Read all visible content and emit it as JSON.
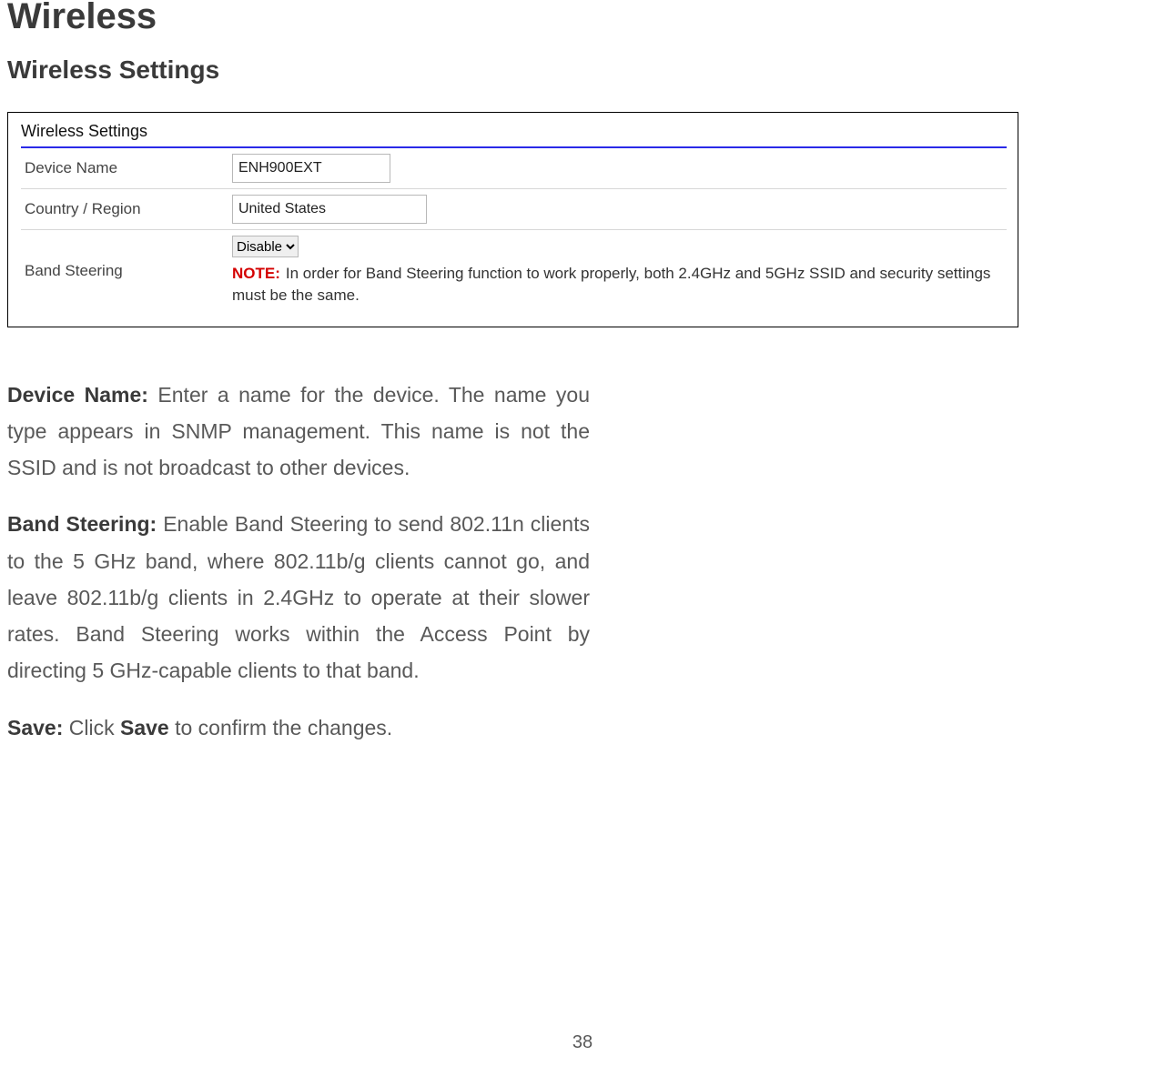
{
  "page": {
    "title": "Wireless",
    "subtitle": "Wireless Settings",
    "number": "38"
  },
  "panel": {
    "heading": "Wireless Settings",
    "rows": {
      "deviceNameLabel": "Device Name",
      "deviceNameValue": "ENH900EXT",
      "countryLabel": "Country / Region",
      "countryValue": "United States",
      "bandSteeringLabel": "Band Steering",
      "bandSteeringValue": "Disable",
      "noteLabel": "NOTE:",
      "noteText": "In order for Band Steering function to work properly, both 2.4GHz and 5GHz SSID and security settings must be the same."
    }
  },
  "descriptions": {
    "deviceName": {
      "label": "Device Name:",
      "text": " Enter a name for the device. The name you type appears in SNMP management. This name is not the SSID and is not broadcast to other devices."
    },
    "bandSteering": {
      "label": "Band Steering:",
      "text": " Enable Band Steering to send 802.11n clients to the 5 GHz band, where 802.11b/g clients cannot go, and leave 802.11b/g clients in 2.4GHz to operate at their slower rates. Band Steering works within the Access Point by directing 5 GHz-capable clients to that band."
    },
    "save": {
      "label": "Save:",
      "text1": " Click ",
      "bold": "Save",
      "text2": " to confirm the changes."
    }
  }
}
